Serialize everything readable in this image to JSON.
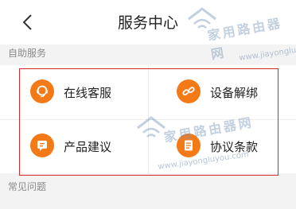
{
  "header": {
    "title": "服务中心"
  },
  "sections": {
    "self_service": "自助服务",
    "faq": "常见问题"
  },
  "services": [
    {
      "label": "在线客服",
      "icon": "customer-service-icon"
    },
    {
      "label": "设备解绑",
      "icon": "unlink-icon"
    },
    {
      "label": "产品建议",
      "icon": "feedback-icon"
    },
    {
      "label": "协议条款",
      "icon": "document-icon"
    }
  ],
  "watermark": {
    "text": "家用路由器网",
    "url": "www.jiayongluyou.com",
    "url_alt": "www.jiayongluyou.com"
  },
  "colors": {
    "accent": "#f47a18",
    "highlight": "#d62a2a"
  }
}
